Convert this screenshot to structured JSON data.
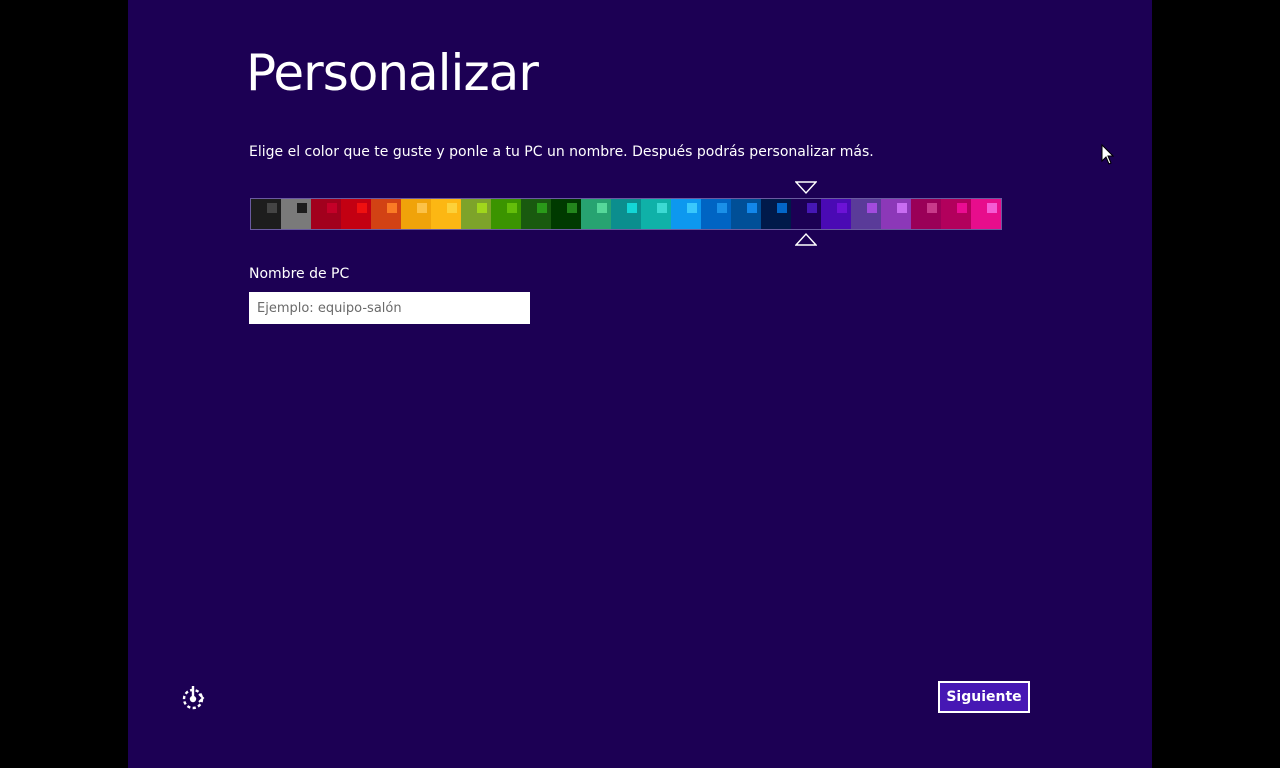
{
  "page": {
    "title": "Personalizar",
    "subtitle": "Elige el color que te guste y ponle a tu PC un nombre. Después podrás personalizar más.",
    "background_color": "#1c0054"
  },
  "palette": {
    "selected_index": 18,
    "swatches": [
      {
        "bg": "#1d1d1d",
        "accent": "#444444"
      },
      {
        "bg": "#7a7a7a",
        "accent": "#1d1d1d"
      },
      {
        "bg": "#a2001d",
        "accent": "#c40028"
      },
      {
        "bg": "#c30012",
        "accent": "#ef1010"
      },
      {
        "bg": "#d24214",
        "accent": "#fa7b25"
      },
      {
        "bg": "#f0a30a",
        "accent": "#fcc248"
      },
      {
        "bg": "#fcb713",
        "accent": "#fcd13a"
      },
      {
        "bg": "#7da32a",
        "accent": "#a0d61c"
      },
      {
        "bg": "#3b9400",
        "accent": "#64be0a"
      },
      {
        "bg": "#195a0f",
        "accent": "#2a9b19"
      },
      {
        "bg": "#003a00",
        "accent": "#23861c"
      },
      {
        "bg": "#27a371",
        "accent": "#56d89a"
      },
      {
        "bg": "#0b8e8e",
        "accent": "#13d6d6"
      },
      {
        "bg": "#0fb1a8",
        "accent": "#3cdad3"
      },
      {
        "bg": "#0d98ef",
        "accent": "#39c8fc"
      },
      {
        "bg": "#0064c3",
        "accent": "#1a90e8"
      },
      {
        "bg": "#004f97",
        "accent": "#1287ea"
      },
      {
        "bg": "#001a4a",
        "accent": "#0367c8"
      },
      {
        "bg": "#1c0054",
        "accent": "#4617b4"
      },
      {
        "bg": "#4a0ab4",
        "accent": "#6c12d6"
      },
      {
        "bg": "#5a3b99",
        "accent": "#a14bde"
      },
      {
        "bg": "#8c38b8",
        "accent": "#c86cf2"
      },
      {
        "bg": "#9a0058",
        "accent": "#c83a8a"
      },
      {
        "bg": "#b2005c",
        "accent": "#ea0c92"
      },
      {
        "bg": "#e70d8c",
        "accent": "#f55bd4"
      }
    ]
  },
  "pc_name": {
    "label": "Nombre de PC",
    "placeholder": "Ejemplo: equipo-salón",
    "value": ""
  },
  "footer": {
    "next_label": "Siguiente",
    "ease_of_access_icon": "ease-of-access-icon"
  }
}
